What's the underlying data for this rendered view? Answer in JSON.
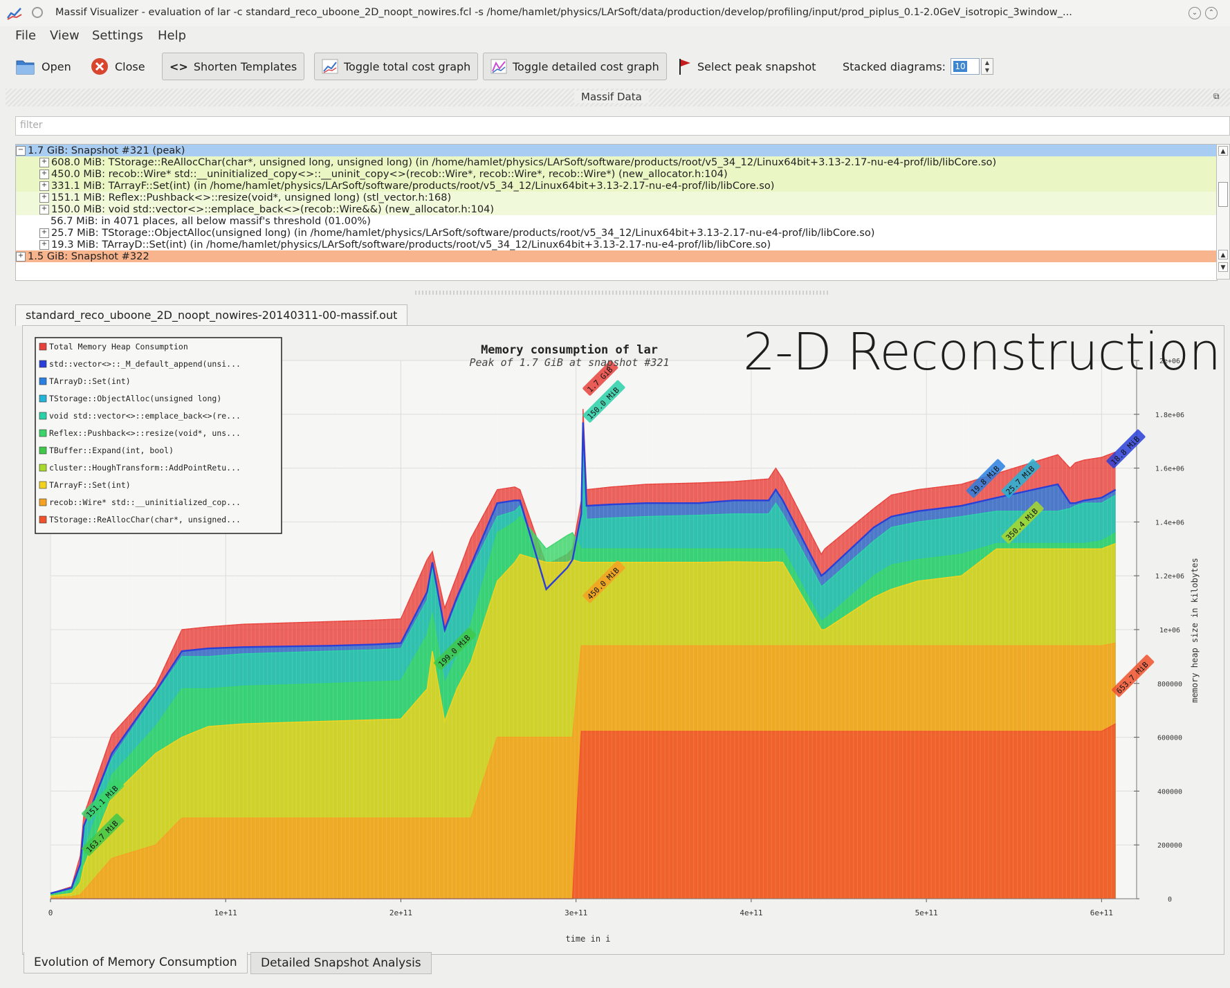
{
  "window": {
    "title": "Massif Visualizer - evaluation of lar -c standard_reco_uboone_2D_noopt_nowires.fcl -s /home/hamlet/physics/LArSoft/data/production/develop/profiling/input/prod_piplus_0.1-2.0GeV_isotropic_3window_..."
  },
  "menu": {
    "file": "File",
    "view": "View",
    "settings": "Settings",
    "help": "Help"
  },
  "toolbar": {
    "open": "Open",
    "close": "Close",
    "shorten": "Shorten Templates",
    "toggle_total": "Toggle total cost graph",
    "toggle_detailed": "Toggle detailed cost graph",
    "select_peak": "Select peak snapshot",
    "stacked_label": "Stacked diagrams:",
    "stacked_value": "10"
  },
  "dock": {
    "title": "Massif Data",
    "filter_placeholder": "filter"
  },
  "tree": {
    "snapshot_peak": "1.7 GiB: Snapshot #321 (peak)",
    "children": [
      "608.0 MiB: TStorage::ReAllocChar(char*, unsigned long, unsigned long) (in /home/hamlet/physics/LArSoft/software/products/root/v5_34_12/Linux64bit+3.13-2.17-nu-e4-prof/lib/libCore.so)",
      "450.0 MiB: recob::Wire* std::__uninitialized_copy<>::__uninit_copy<>(recob::Wire*, recob::Wire*, recob::Wire*) (new_allocator.h:104)",
      "331.1 MiB: TArrayF::Set(int) (in /home/hamlet/physics/LArSoft/software/products/root/v5_34_12/Linux64bit+3.13-2.17-nu-e4-prof/lib/libCore.so)",
      "151.1 MiB: Reflex::Pushback<>::resize(void*, unsigned long) (stl_vector.h:168)",
      "150.0 MiB: void std::vector<>::emplace_back<>(recob::Wire&&) (new_allocator.h:104)",
      "56.7 MiB: in 4071 places, all below massif's threshold (01.00%)",
      "25.7 MiB: TStorage::ObjectAlloc(unsigned long) (in /home/hamlet/physics/LArSoft/software/products/root/v5_34_12/Linux64bit+3.13-2.17-nu-e4-prof/lib/libCore.so)",
      "19.3 MiB: TArrayD::Set(int) (in /home/hamlet/physics/LArSoft/software/products/root/v5_34_12/Linux64bit+3.13-2.17-nu-e4-prof/lib/libCore.so)"
    ],
    "snapshot_next": "1.5 GiB: Snapshot #322"
  },
  "file_tab": "standard_reco_uboone_2D_noopt_nowires-20140311-00-massif.out",
  "overlay_title": "2-D Reconstruction",
  "bottom_tabs": {
    "evolution": "Evolution of Memory Consumption",
    "detailed": "Detailed Snapshot Analysis"
  },
  "chart_data": {
    "type": "area",
    "title": "Memory consumption of lar",
    "subtitle": "Peak of 1.7 GiB at snapshot #321",
    "xlabel": "time in i",
    "ylabel": "memory heap size in kilobytes",
    "xlim": [
      0,
      620000000000
    ],
    "ylim": [
      0,
      2000000
    ],
    "x_ticks": [
      {
        "v": 0,
        "label": "0"
      },
      {
        "v": 100000000000,
        "label": "1e+11"
      },
      {
        "v": 200000000000,
        "label": "2e+11"
      },
      {
        "v": 300000000000,
        "label": "3e+11"
      },
      {
        "v": 400000000000,
        "label": "4e+11"
      },
      {
        "v": 500000000000,
        "label": "5e+11"
      },
      {
        "v": 600000000000,
        "label": "6e+11"
      }
    ],
    "y_ticks": [
      {
        "v": 0,
        "label": "0"
      },
      {
        "v": 200000,
        "label": "200000"
      },
      {
        "v": 400000,
        "label": "400000"
      },
      {
        "v": 600000,
        "label": "600000"
      },
      {
        "v": 800000,
        "label": "800000"
      },
      {
        "v": 1000000,
        "label": "1e+06"
      },
      {
        "v": 1200000,
        "label": "1.2e+06"
      },
      {
        "v": 1400000,
        "label": "1.4e+06"
      },
      {
        "v": 1600000,
        "label": "1.6e+06"
      },
      {
        "v": 1800000,
        "label": "1.8e+06"
      },
      {
        "v": 2000000,
        "label": "2e+06"
      }
    ],
    "legend_position": "top-left",
    "legend": [
      {
        "label": "Total Memory Heap Consumption",
        "color": "#e8413c"
      },
      {
        "label": "std::vector<>::_M_default_append(unsi...",
        "color": "#2a3fd8"
      },
      {
        "label": "TArrayD::Set(int)",
        "color": "#2a7fe0"
      },
      {
        "label": "TStorage::ObjectAlloc(unsigned long)",
        "color": "#23b4d8"
      },
      {
        "label": "void std::vector<>::emplace_back<>(re...",
        "color": "#2ad0a8"
      },
      {
        "label": "Reflex::Pushback<>::resize(void*, uns...",
        "color": "#3ad46a"
      },
      {
        "label": "TBuffer::Expand(int, bool)",
        "color": "#3fc84a"
      },
      {
        "label": "cluster::HoughTransform::AddPointRetu...",
        "color": "#a8d82a"
      },
      {
        "label": "TArrayF::Set(int)",
        "color": "#f2d21c"
      },
      {
        "label": "recob::Wire* std::__uninitialized_cop...",
        "color": "#f5a123"
      },
      {
        "label": "TStorage::ReAllocChar(char*, unsigned...",
        "color": "#f0522d"
      }
    ],
    "x": [
      0,
      12,
      17,
      19,
      35,
      60,
      75,
      90,
      110,
      160,
      185,
      200,
      215,
      218,
      225,
      232,
      240,
      255,
      265,
      268,
      283,
      295,
      298,
      303,
      304,
      306,
      320,
      340,
      370,
      390,
      410,
      414,
      418,
      440,
      442,
      470,
      480,
      495,
      520,
      540,
      575,
      582,
      585,
      590,
      600,
      608
    ],
    "series": [
      {
        "name": "TStorage::ReAllocChar(char*, unsigned...",
        "color": "#f0522d",
        "values": [
          0,
          0,
          0,
          0,
          0,
          0,
          0,
          0,
          0,
          0,
          0,
          0,
          0,
          0,
          0,
          0,
          0,
          0,
          0,
          0,
          0,
          0,
          0,
          622,
          622,
          622,
          622,
          622,
          622,
          622,
          622,
          622,
          622,
          622,
          622,
          622,
          622,
          622,
          622,
          622,
          622,
          622,
          622,
          622,
          622,
          650
        ]
      },
      {
        "name": "recob::Wire* std::__uninitialized_cop...",
        "color": "#f5a123",
        "values": [
          5,
          8,
          15,
          30,
          150,
          200,
          300,
          300,
          300,
          300,
          300,
          300,
          300,
          300,
          300,
          300,
          300,
          600,
          600,
          600,
          600,
          600,
          600,
          940,
          940,
          940,
          940,
          940,
          940,
          940,
          940,
          940,
          940,
          940,
          940,
          940,
          940,
          940,
          940,
          940,
          940,
          940,
          940,
          940,
          940,
          950
        ]
      },
      {
        "name": "TArrayF::Set(int)",
        "color": "#f2d21c",
        "values": [
          10,
          20,
          60,
          120,
          380,
          540,
          600,
          640,
          650,
          660,
          665,
          668,
          780,
          920,
          660,
          780,
          880,
          1180,
          1250,
          1280,
          1250,
          1250,
          1260,
          1250,
          1250,
          1250,
          1250,
          1250,
          1250,
          1252,
          1250,
          1252,
          1250,
          1000,
          1000,
          1120,
          1150,
          1180,
          1200,
          1300,
          1300,
          1300,
          1300,
          1300,
          1300,
          1320
        ]
      },
      {
        "name": "Reflex::Pushback<>::resize(void*, uns...",
        "color": "#3ad46a",
        "values": [
          15,
          30,
          80,
          180,
          460,
          640,
          780,
          780,
          790,
          800,
          806,
          810,
          980,
          1060,
          800,
          900,
          1020,
          1360,
          1400,
          1420,
          1300,
          1350,
          1360,
          1300,
          1300,
          1300,
          1300,
          1300,
          1300,
          1300,
          1300,
          1300,
          1300,
          1030,
          1040,
          1200,
          1240,
          1260,
          1280,
          1320,
          1320,
          1320,
          1320,
          1320,
          1330,
          1360
        ]
      },
      {
        "name": "void std::vector<>::emplace_back<>(re...",
        "color": "#2ad0a8",
        "values": [
          20,
          40,
          120,
          260,
          520,
          760,
          900,
          900,
          910,
          920,
          925,
          930,
          1110,
          1240,
          980,
          1100,
          1220,
          1420,
          1440,
          1460,
          1130,
          1200,
          1240,
          1410,
          1700,
          1410,
          1415,
          1420,
          1425,
          1430,
          1430,
          1470,
          1430,
          1160,
          1170,
          1330,
          1380,
          1400,
          1420,
          1440,
          1440,
          1450,
          1460,
          1470,
          1470,
          1500
        ]
      },
      {
        "name": "TArrayD::Set(int)",
        "color": "#2a7fe0",
        "values": [
          20,
          40,
          128,
          270,
          540,
          770,
          920,
          930,
          935,
          940,
          945,
          950,
          1140,
          1250,
          1000,
          1120,
          1240,
          1470,
          1480,
          1480,
          1150,
          1230,
          1260,
          1430,
          1770,
          1460,
          1465,
          1470,
          1470,
          1480,
          1480,
          1520,
          1480,
          1200,
          1210,
          1380,
          1420,
          1440,
          1460,
          1490,
          1540,
          1470,
          1470,
          1480,
          1490,
          1520
        ]
      },
      {
        "name": "Total Memory Heap Consumption",
        "color": "#e8413c",
        "values": [
          20,
          45,
          160,
          310,
          610,
          790,
          1000,
          1010,
          1020,
          1030,
          1035,
          1040,
          1260,
          1290,
          1080,
          1200,
          1340,
          1520,
          1530,
          1520,
          1240,
          1280,
          1300,
          1480,
          1820,
          1520,
          1530,
          1540,
          1545,
          1550,
          1560,
          1600,
          1560,
          1280,
          1300,
          1450,
          1500,
          1520,
          1540,
          1580,
          1650,
          1600,
          1620,
          1630,
          1640,
          1660
        ]
      }
    ],
    "y_scale_note": "series values in thousands of kilobytes",
    "annotations": [
      {
        "text": "1.7 GiB",
        "x": 306,
        "y": 1880,
        "color": "#e8413c"
      },
      {
        "text": "150.0 MiB",
        "x": 306,
        "y": 1780,
        "color": "#2ad0a8"
      },
      {
        "text": "450.0 MiB",
        "x": 306,
        "y": 1110,
        "color": "#f5a123"
      },
      {
        "text": "199.0 MiB",
        "x": 221,
        "y": 860,
        "color": "#3fc84a"
      },
      {
        "text": "151.1 MiB",
        "x": 20,
        "y": 300,
        "color": "#3ad46a"
      },
      {
        "text": "163.7 MiB",
        "x": 20,
        "y": 170,
        "color": "#3fc84a"
      },
      {
        "text": "19.8 MiB",
        "x": 525,
        "y": 1500,
        "color": "#2a7fe0"
      },
      {
        "text": "25.7 MiB",
        "x": 545,
        "y": 1500,
        "color": "#23b4d8"
      },
      {
        "text": "350.4 MiB",
        "x": 545,
        "y": 1330,
        "color": "#a8d82a"
      },
      {
        "text": "18.8 MiB",
        "x": 605,
        "y": 1610,
        "color": "#2a3fd8"
      },
      {
        "text": "653.7 MiB",
        "x": 608,
        "y": 760,
        "color": "#f0522d"
      }
    ]
  }
}
